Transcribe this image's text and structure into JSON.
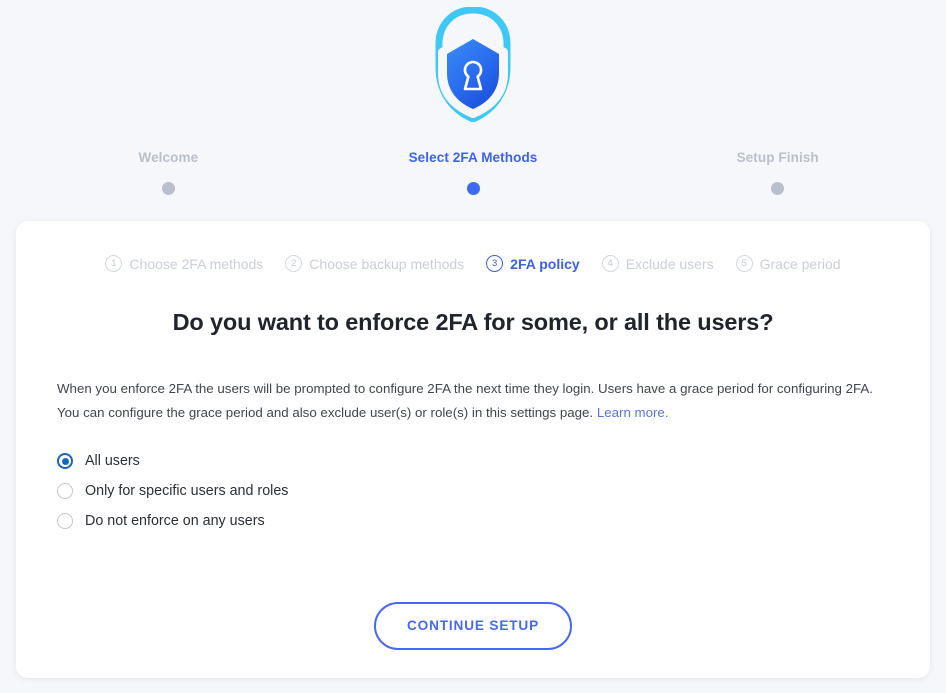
{
  "logo": {
    "name": "shield-lock-logo",
    "outer_color": "#3fc8f5",
    "inner_gradient_from": "#2f7ef0",
    "inner_gradient_to": "#1f5fe0"
  },
  "stepper": {
    "items": [
      {
        "label": "Welcome",
        "active": false
      },
      {
        "label": "Select 2FA Methods",
        "active": true
      },
      {
        "label": "Setup Finish",
        "active": false
      }
    ],
    "inactive_color": "#b9bfcc",
    "active_color": "#3c63e8"
  },
  "substeps": {
    "items": [
      {
        "num": "1",
        "label": "Choose 2FA methods",
        "active": false
      },
      {
        "num": "2",
        "label": "Choose backup methods",
        "active": false
      },
      {
        "num": "3",
        "label": "2FA policy",
        "active": true
      },
      {
        "num": "4",
        "label": "Exclude users",
        "active": false
      },
      {
        "num": "5",
        "label": "Grace period",
        "active": false
      }
    ]
  },
  "main": {
    "heading": "Do you want to enforce 2FA for some, or all the users?",
    "body_text": "When you enforce 2FA the users will be prompted to configure 2FA the next time they login. Users have a grace period for configuring 2FA. You can configure the grace period and also exclude user(s) or role(s) in this settings page. ",
    "learn_more_label": "Learn more.",
    "learn_more_color": "#5b72dc"
  },
  "policy_options": {
    "selected_index": 0,
    "options": [
      {
        "label": "All users",
        "selected": true
      },
      {
        "label": "Only for specific users and roles",
        "selected": false
      },
      {
        "label": "Do not enforce on any users",
        "selected": false
      }
    ],
    "selected_color": "#1666c4"
  },
  "footer": {
    "continue_label": "CONTINUE SETUP",
    "continue_color": "#4668f2"
  }
}
